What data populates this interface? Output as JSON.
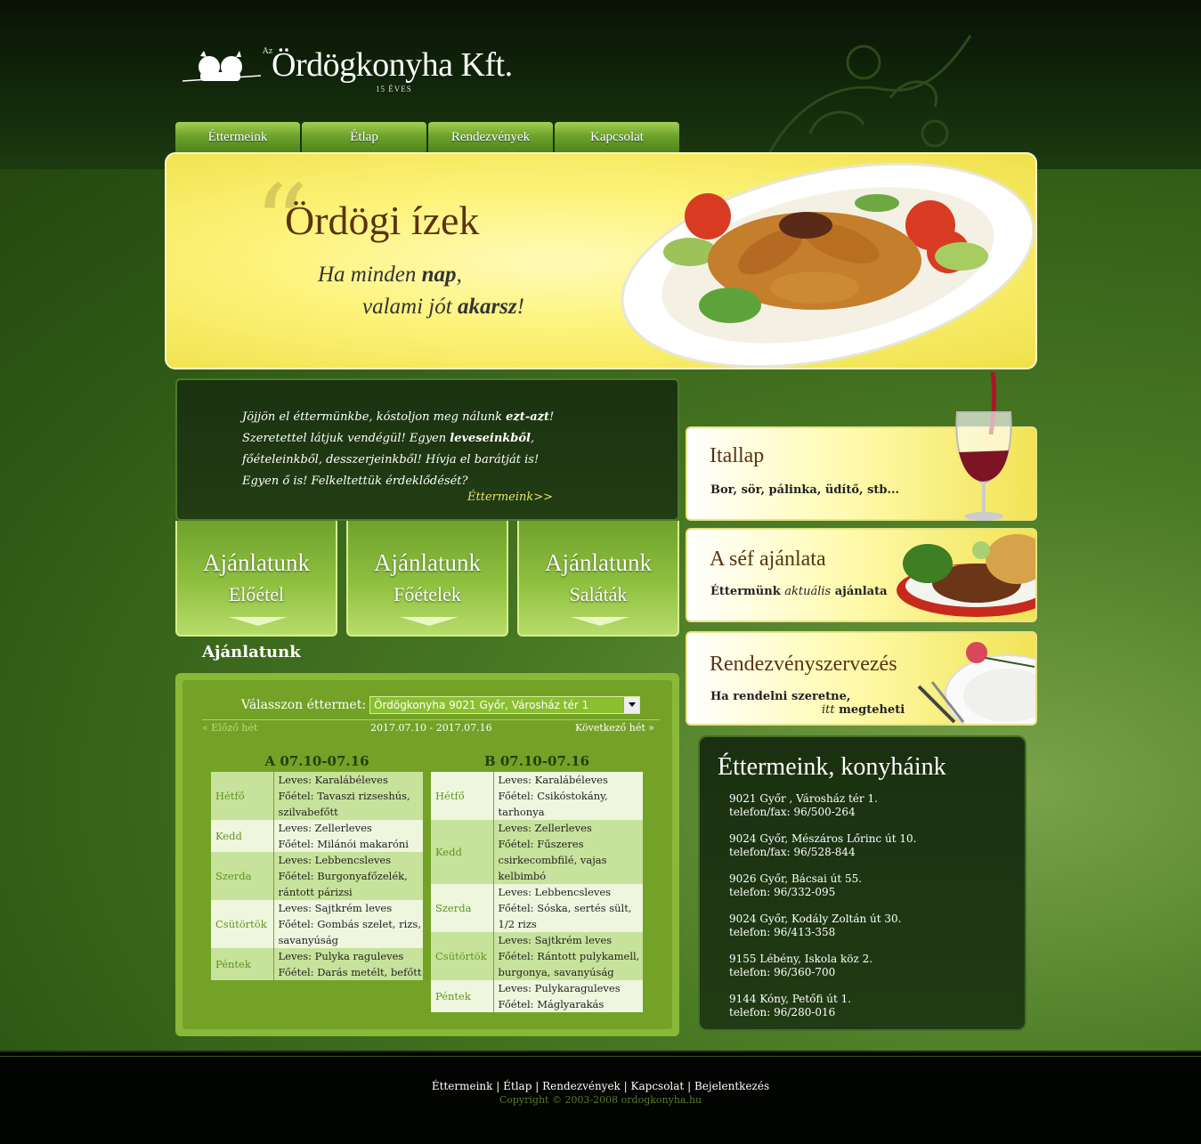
{
  "logo": {
    "prefix": "Az",
    "name": "Ördögkonyha Kft.",
    "years": "15 ÉVES"
  },
  "nav": [
    "Éttermeink",
    "Étlap",
    "Rendezvények",
    "Kapcsolat"
  ],
  "hero": {
    "title": "Ördögi ízek",
    "line1_a": "Ha minden ",
    "line1_b": "nap",
    "line1_c": ",",
    "line2_a": "valami jót ",
    "line2_b": "akarsz",
    "line2_c": "!"
  },
  "intro": {
    "s1": "Jöjjön el éttermünkbe, kóstoljon meg nálunk ",
    "s1b": "ezt-azt",
    "s2": "! Szeretettel látjuk vendégül! Egyen ",
    "s2b": "leveseinkből",
    "s3": ", főételeinkből, desszerjeinkből! Hívja el barátját is! Egyen ő is! Felkeltettük érdeklődését?",
    "more": "Éttermeink>>"
  },
  "tiles": [
    {
      "title": "Ajánlatunk",
      "sub": "Előétel"
    },
    {
      "title": "Ajánlatunk",
      "sub": "Főételek"
    },
    {
      "title": "Ajánlatunk",
      "sub": "Saláták"
    }
  ],
  "menu": {
    "heading": "Ajánlatunk",
    "select_label": "Válasszon éttermet:",
    "select_value": "Ördögkonyha 9021 Győr, Városház tér 1",
    "prev": "« Előző hét",
    "range": "2017.07.10 - 2017.07.16",
    "next": "Következő hét »",
    "a_caption": "A 07.10-07.16",
    "b_caption": "B 07.10-07.16",
    "a_rows": [
      {
        "day": "Hétfő",
        "leves": "Leves: Karalábéleves",
        "foetel": "Főétel: Tavaszi rizseshús, szilvabefőtt"
      },
      {
        "day": "Kedd",
        "leves": "Leves: Zellerleves",
        "foetel": "Főétel: Milánói makaróni"
      },
      {
        "day": "Szerda",
        "leves": "Leves: Lebbencsleves",
        "foetel": "Főétel: Burgonyafőzelék, rántott párizsi"
      },
      {
        "day": "Csütörtök",
        "leves": "Leves: Sajtkrém leves",
        "foetel": "Főétel: Gombás szelet, rizs, savanyúság"
      },
      {
        "day": "Péntek",
        "leves": "Leves: Pulyka raguleves",
        "foetel": "Főétel: Darás metélt, befőtt"
      }
    ],
    "b_rows": [
      {
        "day": "Hétfő",
        "leves": "Leves: Karalábéleves",
        "foetel": "Főétel: Csikóstokány, tarhonya"
      },
      {
        "day": "Kedd",
        "leves": "Leves: Zellerleves",
        "foetel": "Főétel: Fűszeres csirkecombfilé, vajas kelbimbó"
      },
      {
        "day": "Szerda",
        "leves": "Leves: Lebbencsleves",
        "foetel": "Főétel: Sóska, sertés sült, 1/2 rizs"
      },
      {
        "day": "Csütörtök",
        "leves": "Leves: Sajtkrém leves",
        "foetel": "Főétel: Rántott pulykamell, burgonya, savanyúság"
      },
      {
        "day": "Péntek",
        "leves": "Leves: Pulykaraguleves",
        "foetel": "Főétel: Máglyarakás"
      }
    ]
  },
  "right": {
    "drinks_title": "Itallap",
    "drinks_sub": "Bor, sör, pálinka, üdítő, stb...",
    "chef_title": "A séf ajánlata",
    "chef_sub_a": "Éttermünk ",
    "chef_sub_b": "aktuális",
    "chef_sub_c": " ajánlata",
    "event_title": "Rendezvényszervezés",
    "event_sub1": "Ha rendelni szeretne,",
    "event_sub2a": "itt",
    "event_sub2b": " megteheti"
  },
  "restaurants": {
    "title": "Éttermeink, konyháink",
    "items": [
      {
        "addr": "9021 Győr , Városház tér 1.",
        "tel": "telefon/fax: 96/500-264"
      },
      {
        "addr": "9024 Győr, Mészáros Lőrinc út 10.",
        "tel": "telefon/fax: 96/528-844"
      },
      {
        "addr": "9026 Győr, Bácsai út 55.",
        "tel": "telefon: 96/332-095"
      },
      {
        "addr": "9024 Győr, Kodály Zoltán út 30.",
        "tel": "telefon: 96/413-358"
      },
      {
        "addr": "9155 Lébény, Iskola köz 2.",
        "tel": "telefon: 96/360-700"
      },
      {
        "addr": "9144 Kóny, Petőfi út 1.",
        "tel": "telefon: 96/280-016"
      }
    ]
  },
  "footer": {
    "links": [
      "Éttermeink",
      "Étlap",
      "Rendezvények",
      "Kapcsolat",
      "Bejelentkezés"
    ],
    "separator": "|",
    "copyright": "Copyright © 2003-2008 ordogkonyha.hu"
  },
  "colors": {
    "accent_green": "#8ab838",
    "dark_green": "#1b3210",
    "hero_yellow": "#fdf37a",
    "title_brown": "#5a3312"
  }
}
